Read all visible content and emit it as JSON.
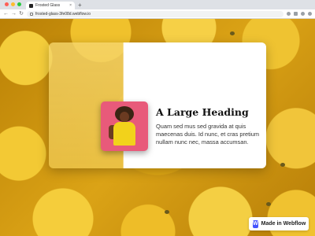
{
  "browser": {
    "tab_title": "Frosted Glass",
    "url": "frosted-glass-3fe08d.webflow.io",
    "newtab_glyph": "+",
    "tab_close_glyph": "×",
    "nav": {
      "back": "←",
      "forward": "→",
      "reload": "↻"
    }
  },
  "card": {
    "heading": "A Large Heading",
    "body": "Quam sed mus sed gravida at quis maecenas duis. Id nunc, et cras pretium nullam nunc nec, massa accumsan."
  },
  "badge": {
    "label": "Made in Webflow",
    "logo_letter": "W"
  },
  "colors": {
    "webflow_brand": "#4353ff",
    "lemon_yellow": "#f4cd3b"
  }
}
